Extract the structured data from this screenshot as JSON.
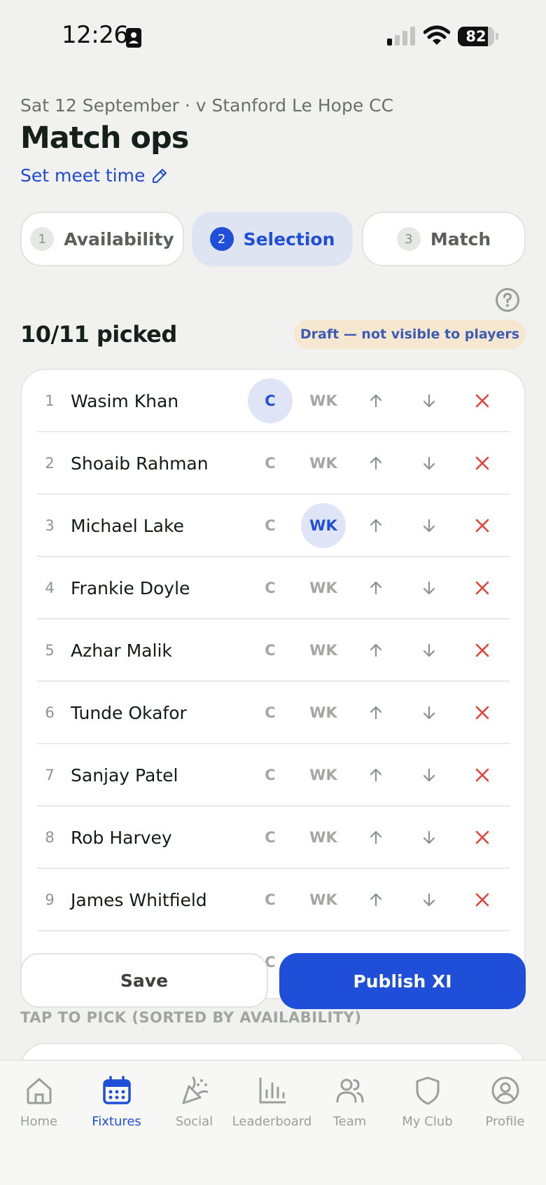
{
  "status_bar": {
    "time": "12:26",
    "battery": "82",
    "battery_level": 0.82
  },
  "header": {
    "subtitle": "Sat 12 September · v Stanford Le Hope CC",
    "title": "Match ops",
    "meet_link": "Set meet time"
  },
  "steps": [
    {
      "num": "1",
      "label": "Availability"
    },
    {
      "num": "2",
      "label": "Selection",
      "active": true
    },
    {
      "num": "3",
      "label": "Match"
    }
  ],
  "selection": {
    "picked": "10/11 picked",
    "badge": "Draft — not visible to players",
    "captain_label": "C",
    "keeper_label": "WK",
    "players": [
      {
        "num": "1",
        "name": "Wasim Khan",
        "captain": true,
        "keeper": false
      },
      {
        "num": "2",
        "name": "Shoaib Rahman",
        "captain": false,
        "keeper": false
      },
      {
        "num": "3",
        "name": "Michael Lake",
        "captain": false,
        "keeper": true
      },
      {
        "num": "4",
        "name": "Frankie Doyle",
        "captain": false,
        "keeper": false
      },
      {
        "num": "5",
        "name": "Azhar Malik",
        "captain": false,
        "keeper": false
      },
      {
        "num": "6",
        "name": "Tunde Okafor",
        "captain": false,
        "keeper": false
      },
      {
        "num": "7",
        "name": "Sanjay Patel",
        "captain": false,
        "keeper": false
      },
      {
        "num": "8",
        "name": "Rob Harvey",
        "captain": false,
        "keeper": false
      },
      {
        "num": "9",
        "name": "James Whitfield",
        "captain": false,
        "keeper": false
      }
    ]
  },
  "actions": {
    "save": "Save",
    "publish": "Publish XI"
  },
  "pick_section": {
    "heading": "TAP TO PICK (SORTED BY AVAILABILITY)"
  },
  "nav": [
    {
      "label": "Home",
      "icon": "home-icon"
    },
    {
      "label": "Fixtures",
      "icon": "calendar-icon",
      "active": true
    },
    {
      "label": "Social",
      "icon": "party-icon"
    },
    {
      "label": "Leaderboard",
      "icon": "bar-chart-icon"
    },
    {
      "label": "Team",
      "icon": "users-icon"
    },
    {
      "label": "My Club",
      "icon": "shield-icon"
    },
    {
      "label": "Profile",
      "icon": "user-circle-icon"
    }
  ],
  "colors": {
    "accent": "#1f4fd8",
    "remove": "#e0443c",
    "background": "#f1f2f0",
    "badge_bg": "#f6e7d0"
  }
}
